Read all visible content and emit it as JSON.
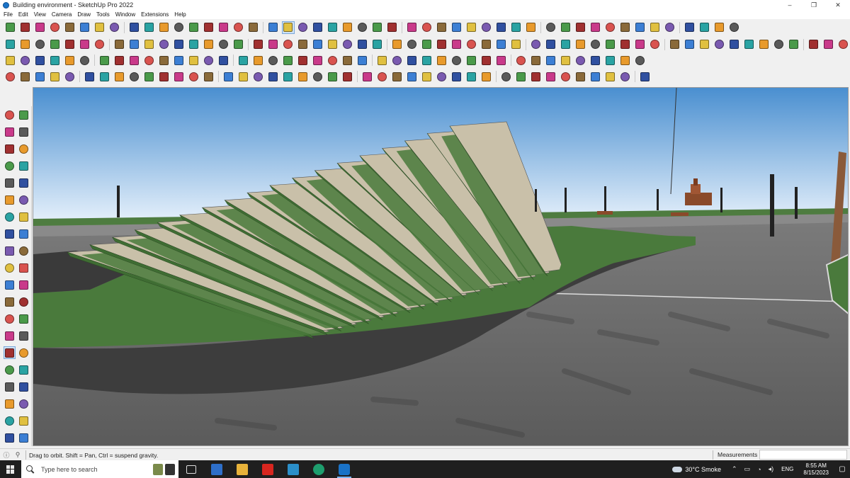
{
  "window": {
    "title": "Building environment - SketchUp Pro 2022",
    "controls": [
      "–",
      "❐",
      "✕"
    ]
  },
  "menu": [
    "File",
    "Edit",
    "View",
    "Camera",
    "Draw",
    "Tools",
    "Window",
    "Extensions",
    "Help"
  ],
  "toolbars": {
    "row1_count": 48,
    "row2_count": 55,
    "row3_count": 42,
    "row4_count": 42
  },
  "left_tools": [
    [
      "select-icon",
      "component-icon"
    ],
    [
      "paint-bucket-icon",
      "eraser-icon"
    ],
    [
      "tag-icon",
      "pencil-icon"
    ],
    [
      "line-icon",
      "freehand-icon"
    ],
    [
      "rectangle-icon",
      "rotated-rectangle-icon"
    ],
    [
      "circle-icon",
      "polygon-icon"
    ],
    [
      "arc-icon",
      "two-point-arc-icon"
    ],
    [
      "pie-icon",
      "offset-icon"
    ],
    [
      "move-icon",
      "push-pull-icon"
    ],
    [
      "rotate-icon",
      "follow-me-icon"
    ],
    [
      "scale-icon",
      "offset-tool-icon"
    ],
    [
      "tape-measure-icon",
      "dimension-icon"
    ],
    [
      "protractor-icon",
      "text-icon"
    ],
    [
      "axes-icon",
      "3d-text-icon"
    ],
    [
      "orbit-icon",
      "pan-icon"
    ],
    [
      "zoom-icon",
      "zoom-window-icon"
    ],
    [
      "zoom-extents-icon",
      "previous-view-icon"
    ],
    [
      "position-camera-icon",
      "look-around-icon"
    ],
    [
      "walk-icon",
      "section-plane-icon"
    ],
    [
      "sandbox-icon",
      "smoove-icon"
    ],
    [
      "stamp-icon",
      "drape-icon"
    ]
  ],
  "status": {
    "message": "Drag to orbit. Shift = Pan, Ctrl = suspend gravity.",
    "measurements_label": "Measurements",
    "measurements_value": ""
  },
  "taskbar": {
    "search_placeholder": "Type here to search",
    "weather": "30°C  Smoke",
    "language": "ENG",
    "time": "8:55 AM",
    "date": "8/15/2023"
  },
  "colors": {
    "sky_top": "#4a8fd0",
    "sky_horizon": "#e2eefa",
    "grass": "#4a7a3c",
    "steps": "#c9c0a9",
    "pavement": "#6d6d6d",
    "taskbar": "#1f1f1f"
  }
}
